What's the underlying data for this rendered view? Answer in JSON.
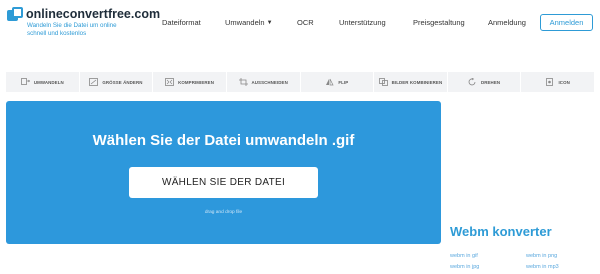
{
  "header": {
    "logo_text": "onlineconvertfree.com",
    "logo_sub": "Wandeln Sie die Datei um online schnell und kostenlos",
    "nav": {
      "dateiformat": "Dateiformat",
      "umwandeln": "Umwandeln",
      "ocr": "OCR",
      "unterstuetzung": "Unterstützung",
      "preisgestaltung": "Preisgestaltung",
      "anmeldung": "Anmeldung"
    },
    "anmelden_button": "Anmelden"
  },
  "toolbar": {
    "items": [
      {
        "label": "Umwandeln",
        "icon": "convert-icon"
      },
      {
        "label": "Größe ändern",
        "icon": "resize-icon"
      },
      {
        "label": "Komprimieren",
        "icon": "compress-icon"
      },
      {
        "label": "Ausschneiden",
        "icon": "crop-icon"
      },
      {
        "label": "Flip",
        "icon": "flip-icon"
      },
      {
        "label": "Bilder kombinieren",
        "icon": "combine-icon"
      },
      {
        "label": "Drehen",
        "icon": "rotate-icon"
      },
      {
        "label": "Icon",
        "icon": "icon-icon"
      }
    ]
  },
  "upload": {
    "title": "Wählen Sie der Datei umwandeln .gif",
    "button": "WÄHLEN SIE DER DATEI",
    "dnd": "drag and drop file"
  },
  "sidebar": {
    "title": "Webm konverter",
    "links": {
      "gif": "webm in gif",
      "png": "webm in png",
      "jpg": "webm in jpg",
      "mp3": "webm in mp3"
    }
  },
  "colors": {
    "accent": "#2e9bd6",
    "upload_bg": "#2d98dc",
    "toolbar_bg": "#f2f3f5"
  }
}
